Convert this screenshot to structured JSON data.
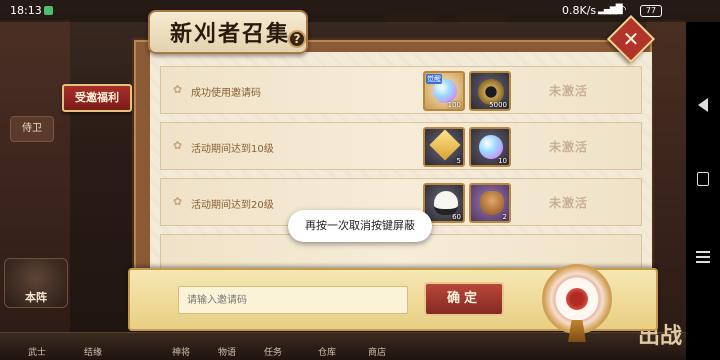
{
  "status_bar": {
    "time": "18:13",
    "network_speed": "0.8K/s",
    "battery": "77"
  },
  "background": {
    "left_buttons": [
      "侍卫"
    ],
    "home_label": "本阵",
    "bottom_items": [
      "武士",
      "结缘",
      "神将",
      "物语",
      "任务",
      "仓库",
      "商店"
    ],
    "right_big": "出战"
  },
  "dialog": {
    "title": "新刈者召集",
    "help_label": "?",
    "close_label": "✕",
    "side_tab": "受邀福利",
    "rows": [
      {
        "label": "成功使用邀请码",
        "items": [
          {
            "icon": "orb-icon",
            "count": "100",
            "tag": "觉醒"
          },
          {
            "icon": "coin-icon",
            "count": "5000"
          }
        ],
        "status": "未激活"
      },
      {
        "label": "活动期间达到10级",
        "items": [
          {
            "icon": "gem-icon",
            "count": "5"
          },
          {
            "icon": "crystal-icon",
            "count": "10"
          }
        ],
        "status": "未激活"
      },
      {
        "label": "活动期间达到20级",
        "items": [
          {
            "icon": "rice-ball-icon",
            "count": "60"
          },
          {
            "icon": "bag-icon",
            "count": "2"
          }
        ],
        "status": "未激活"
      }
    ],
    "input_placeholder": "请输入邀请码",
    "confirm_label": "确定"
  },
  "toast": {
    "message": "再按一次取消按键屏蔽"
  }
}
